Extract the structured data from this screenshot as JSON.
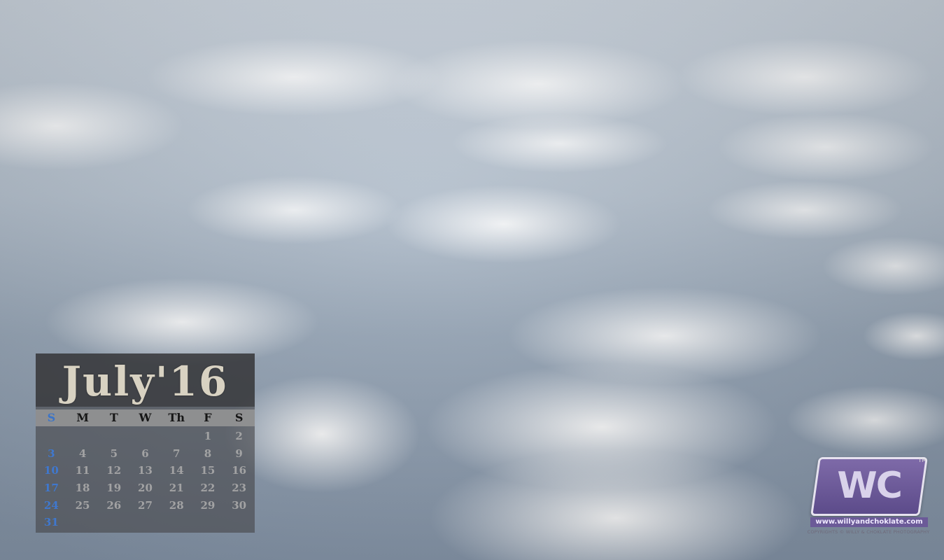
{
  "calendar": {
    "title": "July'16",
    "weekdays": [
      "S",
      "M",
      "T",
      "W",
      "Th",
      "F",
      "S"
    ],
    "sunday_color": "#3b74c8",
    "weeks": [
      [
        "",
        "",
        "",
        "",
        "",
        "1",
        "2"
      ],
      [
        "3",
        "4",
        "5",
        "6",
        "7",
        "8",
        "9"
      ],
      [
        "10",
        "11",
        "12",
        "13",
        "14",
        "15",
        "16"
      ],
      [
        "17",
        "18",
        "19",
        "20",
        "21",
        "22",
        "23"
      ],
      [
        "24",
        "25",
        "26",
        "27",
        "28",
        "29",
        "30"
      ],
      [
        "31",
        "",
        "",
        "",
        "",
        "",
        ""
      ]
    ]
  },
  "logo": {
    "mark": "WC",
    "tm": "TM",
    "url": "www.willyandchoklate.com",
    "copyright": "COPYRIGHTS © WILLY & CHOKLATE PHOTOGRAPHY",
    "brand_color": "#6b5a98"
  }
}
